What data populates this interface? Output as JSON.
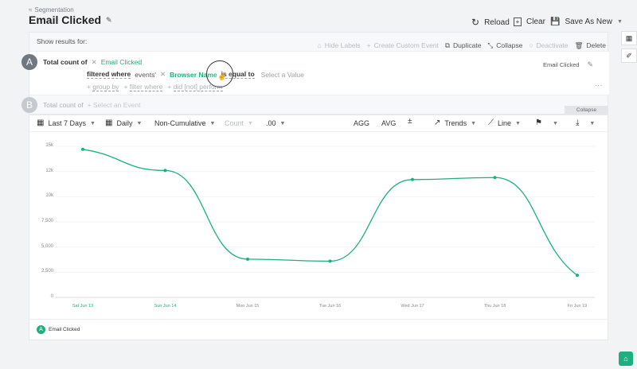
{
  "header": {
    "breadcrumb": "Segmentation",
    "title": "Email Clicked",
    "reload": "Reload",
    "clear": "Clear",
    "save_as_new": "Save As New"
  },
  "results_bar": {
    "label": "Show results for:",
    "hide_labels": "Hide Labels",
    "create_custom_event": "Create Custom Event",
    "duplicate": "Duplicate",
    "collapse": "Collapse",
    "deactivate": "Deactivate",
    "delete": "Delete"
  },
  "event_a": {
    "badge": "A",
    "total_count_of": "Total count of",
    "event_name": "Email Clicked",
    "filtered_where": "filtered where",
    "events_word": "events'",
    "property": "Browser Name",
    "operator": "is equal to",
    "value_placeholder": "Select a Value",
    "group_by": "group by",
    "filter_where": "filter where",
    "did_not_perform": "did [not] perform",
    "right_label": "Email Clicked"
  },
  "event_b": {
    "badge": "B",
    "total_count_of": "Total count of",
    "placeholder": "Select an Event",
    "collapse": "Collapse"
  },
  "controls": {
    "date_range": "Last 7 Days",
    "interval": "Daily",
    "cumulative": "Non-Cumulative",
    "metric": "Count",
    "decimals": ".00",
    "agg": "AGG",
    "avg": "AVG",
    "trends": "Trends",
    "chart_type": "Line"
  },
  "chart_data": {
    "type": "line",
    "categories": [
      "Sat Jun 13",
      "Sun Jun 14",
      "Mon Jun 15",
      "Tue Jun 16",
      "Wed Jun 17",
      "Thu Jun 18",
      "Fri Jun 19"
    ],
    "y_ticks": [
      "0",
      "2,500",
      "5,000",
      "7,500",
      "10k",
      "12k",
      "15k"
    ],
    "ylim": [
      0,
      15000
    ],
    "grid": true,
    "series": [
      {
        "name": "Email Clicked",
        "values": [
          14700,
          12600,
          3800,
          3600,
          11700,
          11900,
          2200
        ]
      }
    ],
    "color": "#1eaf7e"
  },
  "legend": {
    "badge": "A",
    "label": "Email Clicked"
  }
}
